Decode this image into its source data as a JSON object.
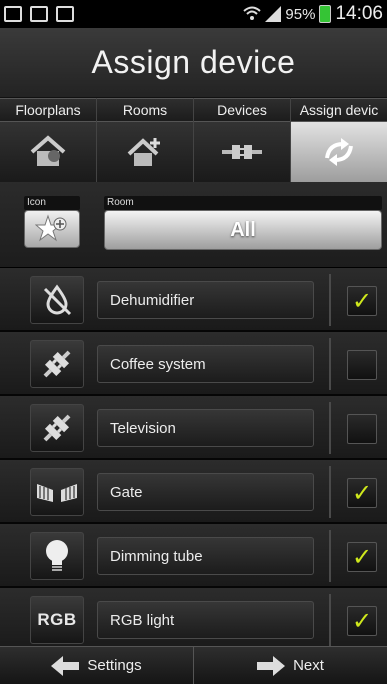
{
  "status_bar": {
    "battery": "95%",
    "time": "14:06",
    "icons": [
      "picture-icon",
      "page-icon",
      "clipboard-check-icon",
      "wifi-icon",
      "signal-icon",
      "battery-icon"
    ]
  },
  "title": "Assign device",
  "tabs": [
    {
      "label": "Floorplans",
      "icon": "house-map-icon"
    },
    {
      "label": "Rooms",
      "icon": "house-plus-icon"
    },
    {
      "label": "Devices",
      "icon": "plug-icon"
    },
    {
      "label": "Assign devic",
      "icon": "assign-arrows-icon",
      "active": true
    }
  ],
  "filter": {
    "icon_label": "Icon",
    "room_label": "Room",
    "room_value": "All",
    "icon_button_icon": "star-plus-icon"
  },
  "devices": [
    {
      "name": "Dehumidifier",
      "icon": "no-drop-icon",
      "checked": true
    },
    {
      "name": "Coffee system",
      "icon": "plug-icon",
      "checked": false
    },
    {
      "name": "Television",
      "icon": "plug-icon",
      "checked": false
    },
    {
      "name": "Gate",
      "icon": "gate-icon",
      "checked": true
    },
    {
      "name": "Dimming tube",
      "icon": "bulb-icon",
      "checked": true
    },
    {
      "name": "RGB light",
      "icon": "rgb-icon",
      "icon_text": "RGB",
      "checked": true
    }
  ],
  "check_mark": "✓",
  "bottom": {
    "settings_label": "Settings",
    "next_label": "Next"
  },
  "colors": {
    "accent_check": "#cfe81c",
    "battery": "#35c435"
  }
}
